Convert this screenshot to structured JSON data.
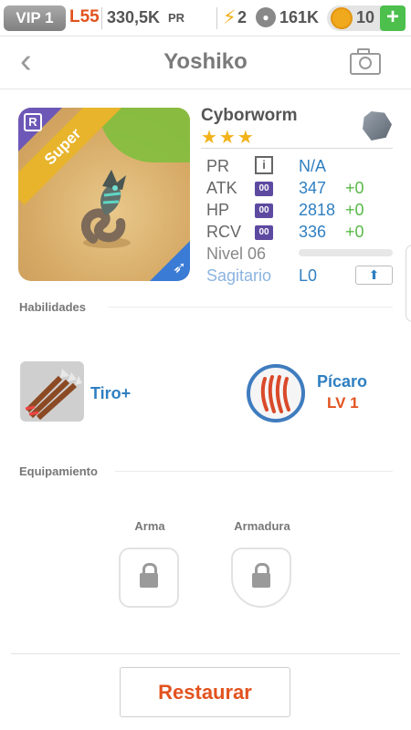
{
  "status_bar": {
    "vip": "VIP 1",
    "level": "L55",
    "power_value": "330,5K",
    "power_label": "PR",
    "energy_icon": "bolt-icon",
    "energy": "2",
    "food_icon": "paw-icon",
    "food": "161K",
    "gold_icon": "coin-icon",
    "gold": "10",
    "add_label": "+"
  },
  "header": {
    "back_icon": "chevron-left-icon",
    "back_label": "‹",
    "title": "Yoshiko",
    "camera_icon": "camera-icon"
  },
  "monster": {
    "rarity_badge": "R",
    "tier_label": "Super",
    "class_icon": "sagittarius-arrow-icon",
    "name": "Cyborworm",
    "stars": "★★★",
    "element_icon": "rock-gem-icon",
    "stats": {
      "pr_label": "PR",
      "pr_value": "N/A",
      "info_label": "i",
      "atk_label": "ATK",
      "atk_value": "347",
      "atk_bonus": "+0",
      "hp_label": "HP",
      "hp_value": "2818",
      "hp_bonus": "+0",
      "rcv_label": "RCV",
      "rcv_value": "336",
      "rcv_bonus": "+0",
      "badge_label": "00",
      "level_label": "Nivel 06",
      "level_progress": 0,
      "sign_label": "Sagitario",
      "sign_value": "L0",
      "upgrade_icon": "arrow-up-icon"
    }
  },
  "abilities": {
    "section_label": "Habilidades",
    "skill1_name": "Tiro+",
    "skill1_icon": "arrows-icon",
    "skill2_name": "Pícaro",
    "skill2_level": "LV 1",
    "skill2_icon": "claw-icon"
  },
  "equipment": {
    "section_label": "Equipamiento",
    "weapon_label": "Arma",
    "armor_label": "Armadura",
    "lock_icon": "lock-icon"
  },
  "actions": {
    "restore_label": "Restaurar"
  },
  "colors": {
    "accent_blue": "#2f7fc1",
    "accent_orange": "#e2531f",
    "bonus_green": "#58b947",
    "star_gold": "#f2b21a"
  }
}
